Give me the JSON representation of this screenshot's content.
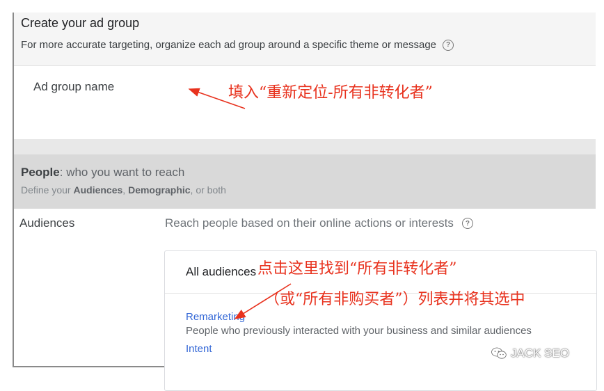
{
  "header": {
    "title": "Create your ad group",
    "subtitle": "For more accurate targeting, organize each ad group around a specific theme or message"
  },
  "ad_group_name": {
    "label": "Ad group name",
    "value": ""
  },
  "people": {
    "title_bold": "People",
    "title_rest": ": who you want to reach",
    "sub_pre": "Define your ",
    "sub_audiences": "Audiences",
    "sub_comma": ", ",
    "sub_demographic": "Demographic",
    "sub_post": ", or both"
  },
  "audiences": {
    "label": "Audiences",
    "description": "Reach people based on their online actions or interests",
    "box_title": "All audiences",
    "items": [
      {
        "label": "Remarketing",
        "description": "People who previously interacted with your business and similar audiences"
      },
      {
        "label": "Intent"
      }
    ]
  },
  "annotations": {
    "fill_name": "填入“重新定位-所有非转化者”",
    "click_here": "点击这里找到“所有非转化者”",
    "or_list": "（或“所有非购买者”）列表并将其选中"
  },
  "watermark": "JACK SEO",
  "colors": {
    "annotation_red": "#e8321e",
    "link_blue": "#3367d6",
    "section_gray": "#d9d9d9"
  },
  "icons": [
    "help-circle-icon",
    "wechat-icon"
  ]
}
